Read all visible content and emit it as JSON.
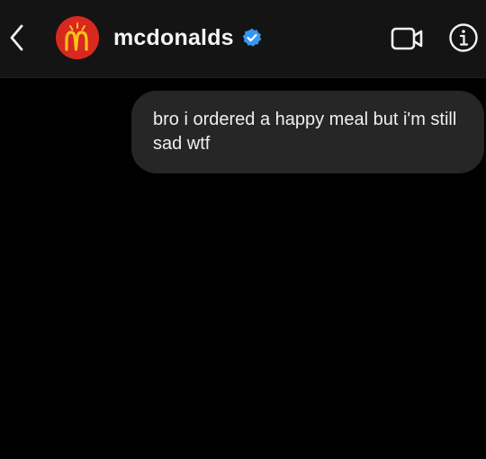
{
  "header": {
    "username": "mcdonalds",
    "avatar_icon": "mcdonalds-logo-icon",
    "verified_icon": "verified-badge-icon",
    "back_icon": "chevron-left-icon",
    "video_icon": "video-camera-icon",
    "info_icon": "info-icon"
  },
  "messages": [
    {
      "sender": "me",
      "text": "bro i ordered a happy meal but i'm still sad wtf"
    }
  ],
  "colors": {
    "background": "#000000",
    "header_bg": "#141414",
    "bubble_bg": "#262626",
    "avatar_red": "#d8281f",
    "verified_blue": "#3797f0"
  }
}
